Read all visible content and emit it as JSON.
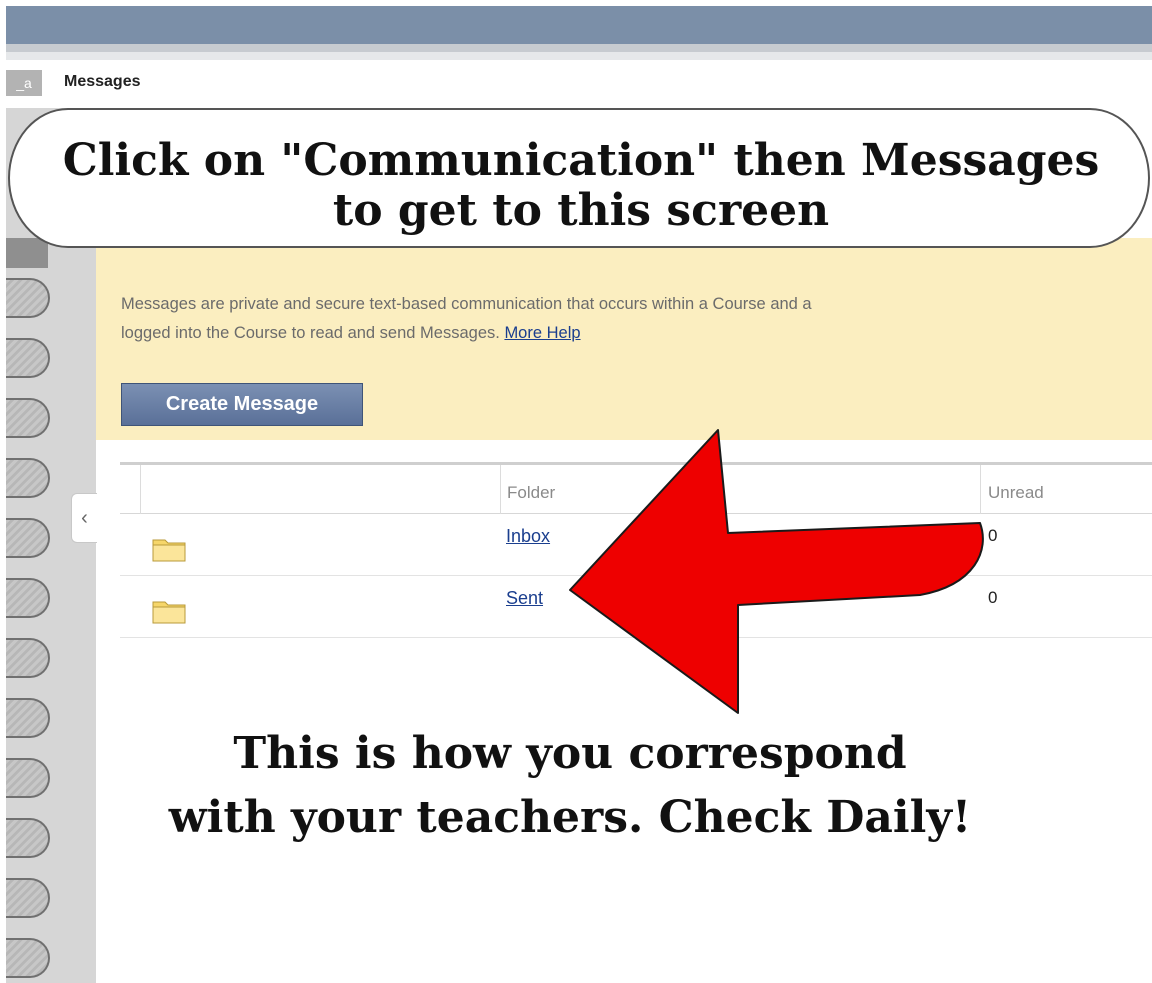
{
  "header": {
    "tab_id": "_a",
    "title": "Messages"
  },
  "callout": {
    "line1": "Click on \"Communication\" then Messages",
    "line2": "to get to this screen"
  },
  "info": {
    "line1": "Messages are private and secure text-based communication that occurs within a Course and a",
    "line2": "logged into the Course to read and send Messages.",
    "help_link": "More Help"
  },
  "create_button": "Create Message",
  "table": {
    "headers": {
      "folder": "Folder",
      "unread": "Unread"
    },
    "rows": [
      {
        "name": "Inbox",
        "unread": "0"
      },
      {
        "name": "Sent",
        "unread": "0"
      }
    ]
  },
  "caption": {
    "line1": "This is how you correspond",
    "line2": "with your teachers.  Check Daily!"
  },
  "colors": {
    "arrow": "#ee0000",
    "panel": "#fbeec0",
    "button": "#5a7098",
    "top_bar": "#7b8fa8"
  },
  "icons": {
    "folder": "folder-icon",
    "collapse": "chevron-left-icon"
  }
}
